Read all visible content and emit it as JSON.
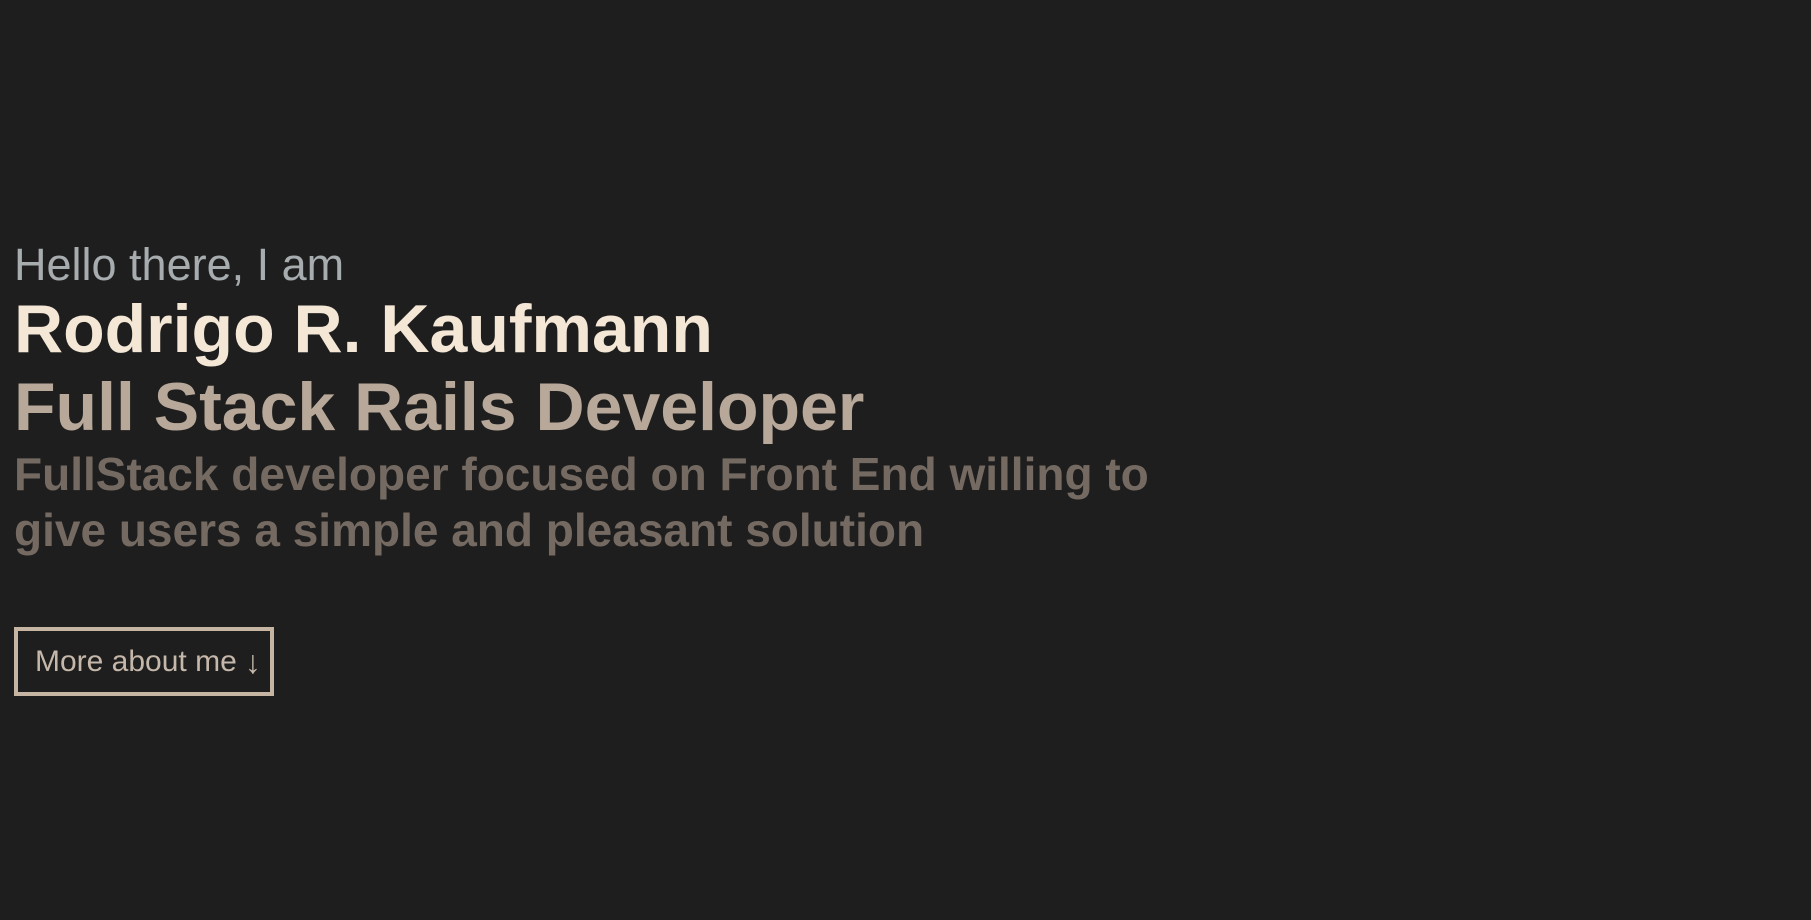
{
  "hero": {
    "greeting": "Hello there, I am",
    "name": "Rodrigo R. Kaufmann",
    "role": "Full Stack Rails Developer",
    "summary": "FullStack developer focused on Front End willing to give users a simple and pleasant solution"
  },
  "cta": {
    "label": "More about me",
    "icon": "↓"
  },
  "colors": {
    "background": "#1e1e1e",
    "greeting": "#a7acaf",
    "name": "#f4e7d6",
    "role": "#b8a89a",
    "summary": "#746a62",
    "accent": "#c7b5a3"
  }
}
